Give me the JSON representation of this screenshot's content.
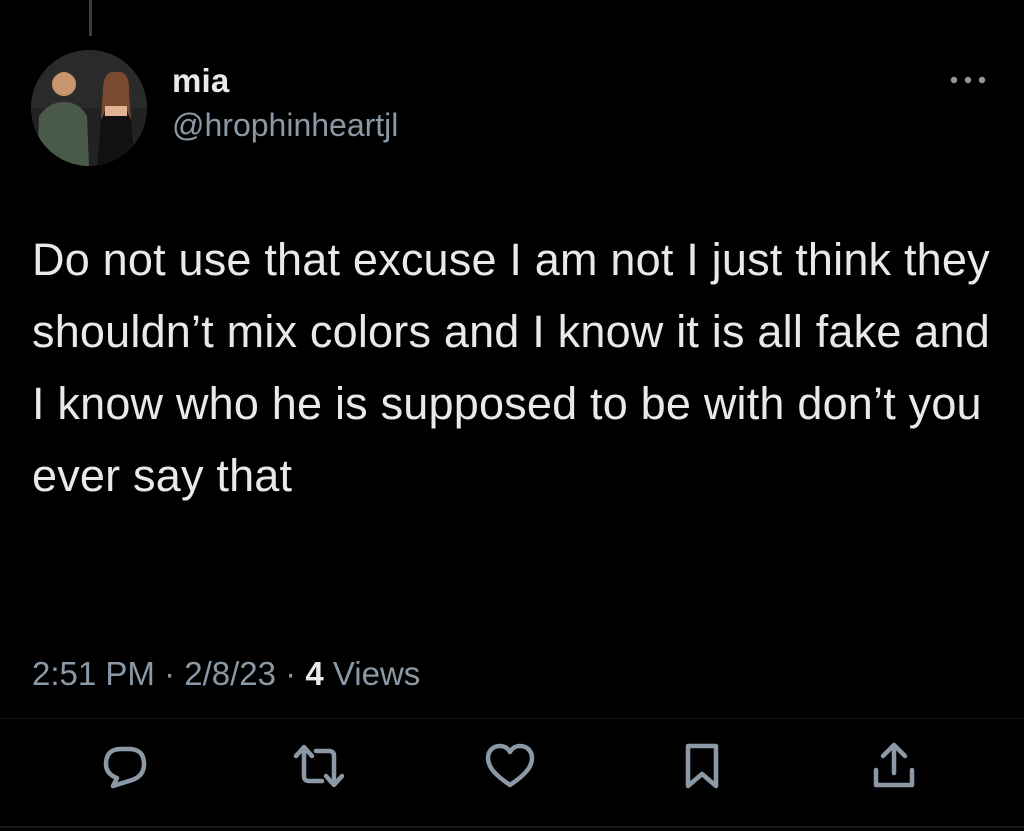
{
  "author": {
    "display_name": "mia",
    "handle": "@hrophinheartjl"
  },
  "tweet": {
    "text": "Do not use that excuse I am not I just think they shouldn’t mix colors and I know it is all fake and I know who he is supposed to be with don’t you ever say that",
    "time": "2:51 PM",
    "separator": "·",
    "date": "2/8/23",
    "views_count": "4",
    "views_label": "Views"
  },
  "actions": [
    {
      "icon": "reply-icon"
    },
    {
      "icon": "retweet-icon"
    },
    {
      "icon": "like-icon"
    },
    {
      "icon": "bookmark-icon"
    },
    {
      "icon": "share-icon"
    }
  ],
  "colors": {
    "background": "#000000",
    "primary_text": "#e7e9ea",
    "secondary_text": "#8b98a5"
  }
}
